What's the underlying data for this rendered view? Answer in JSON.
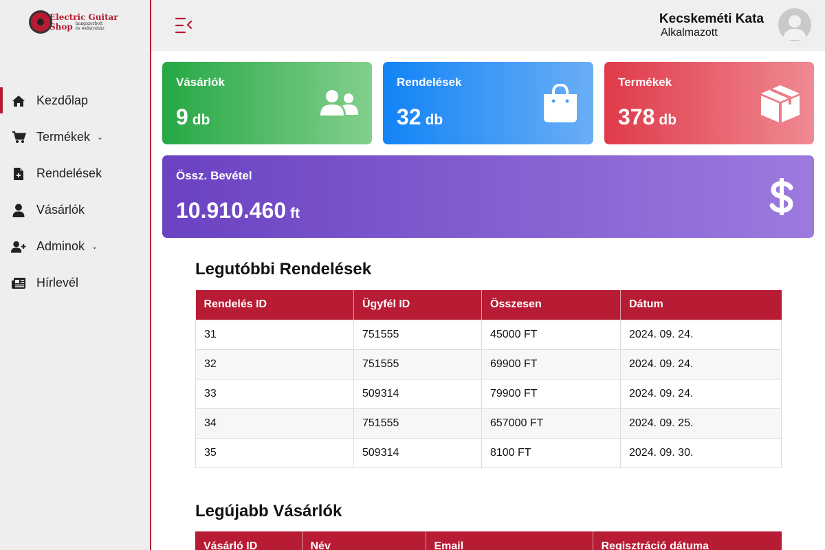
{
  "logo": {
    "line1": "Electric Guitar",
    "line2": "Shop",
    "sub1": "hangszerbolt",
    "sub2": "és webáruház"
  },
  "sidebar": {
    "items": [
      {
        "label": "Kezdőlap",
        "icon": "home-icon",
        "active": true
      },
      {
        "label": "Termékek",
        "icon": "cart-icon",
        "caret": "⌄"
      },
      {
        "label": "Rendelések",
        "icon": "file-plus-icon"
      },
      {
        "label": "Vásárlók",
        "icon": "user-icon"
      },
      {
        "label": "Adminok",
        "icon": "user-plus-icon",
        "caret": "⌄"
      },
      {
        "label": "Hírlevél",
        "icon": "newspaper-icon"
      }
    ]
  },
  "topbar": {
    "user_name": "Kecskeméti Kata",
    "user_role": "Alkalmazott"
  },
  "stats": {
    "customers": {
      "title": "Vásárlók",
      "value": "9",
      "unit": "db",
      "icon": "users-icon",
      "color": "#26a845"
    },
    "orders": {
      "title": "Rendelések",
      "value": "32",
      "unit": "db",
      "icon": "shopping-bag-icon",
      "color": "#1283f6"
    },
    "products": {
      "title": "Termékek",
      "value": "378",
      "unit": "db",
      "icon": "box-icon",
      "color": "#df3a4a"
    },
    "revenue": {
      "title": "Össz. Bevétel",
      "value": "10.910.460",
      "unit": "ft",
      "icon": "dollar-icon",
      "color": "#6a42c2"
    }
  },
  "recent_orders": {
    "title": "Legutóbbi Rendelések",
    "columns": [
      "Rendelés ID",
      "Ügyfél ID",
      "Összesen",
      "Dátum"
    ],
    "rows": [
      [
        "31",
        "751555",
        "45000 FT",
        "2024. 09. 24."
      ],
      [
        "32",
        "751555",
        "69900 FT",
        "2024. 09. 24."
      ],
      [
        "33",
        "509314",
        "79900 FT",
        "2024. 09. 24."
      ],
      [
        "34",
        "751555",
        "657000 FT",
        "2024. 09. 25."
      ],
      [
        "35",
        "509314",
        "8100 FT",
        "2024. 09. 30."
      ]
    ]
  },
  "new_customers": {
    "title": "Legújabb Vásárlók",
    "columns": [
      "Vásárló ID",
      "Név",
      "Email",
      "Regisztráció dátuma"
    ]
  },
  "colors": {
    "accent": "#b81c34",
    "sidebar_bg": "#eeeeee"
  }
}
